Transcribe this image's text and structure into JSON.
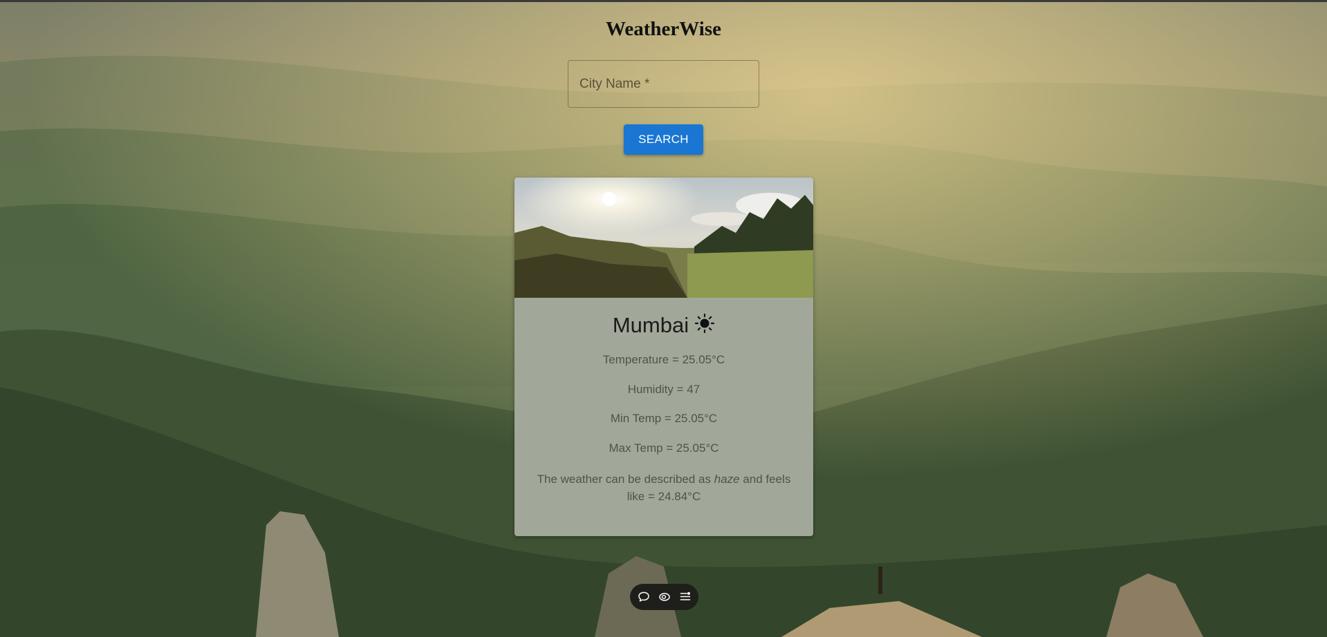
{
  "app": {
    "title": "WeatherWise"
  },
  "search": {
    "placeholder": "City Name *",
    "value": "",
    "button_label": "SEARCH"
  },
  "weather": {
    "city": "Mumbai",
    "condition_icon": "sun-icon",
    "temperature_line": "Temperature = 25.05°C",
    "humidity_line": "Humidity = 47",
    "min_temp_line": "Min Temp = 25.05°C",
    "max_temp_line": "Max Temp = 25.05°C",
    "description_prefix": "The weather can be described as ",
    "description_condition": "haze",
    "description_suffix": " and feels like = 24.84°C"
  },
  "toolbar": {
    "icons": [
      "comment-icon",
      "eye-icon",
      "list-settings-icon"
    ]
  },
  "colors": {
    "button": "#1a76d2",
    "card_background": "#a2a899",
    "toolbar_background": "#1e1e1b"
  }
}
